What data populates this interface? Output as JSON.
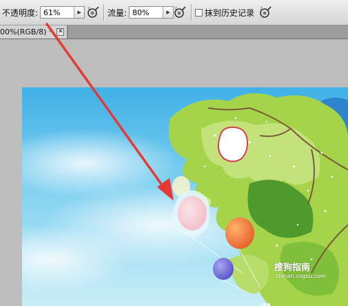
{
  "options_bar": {
    "opacity_label": "不透明度:",
    "opacity_value": "61%",
    "flow_label": "流量:",
    "flow_value": "80%",
    "history_label": "抹到历史记录"
  },
  "document": {
    "tab_title": "00%(RGB/8) *",
    "close_glyph": "✕"
  },
  "watermark": {
    "brand": "搜狗指南",
    "url": "zhinan.sogou.com"
  },
  "colors": {
    "annotation_arrow": "#e53935",
    "sky": "#4fb9e8",
    "leaves": "#9fd03e"
  },
  "icons": {
    "airbrush": "airbrush-icon",
    "dropdown": "triangle-right-icon",
    "close": "close-icon",
    "watermark_logo": "paw-logo-icon"
  }
}
